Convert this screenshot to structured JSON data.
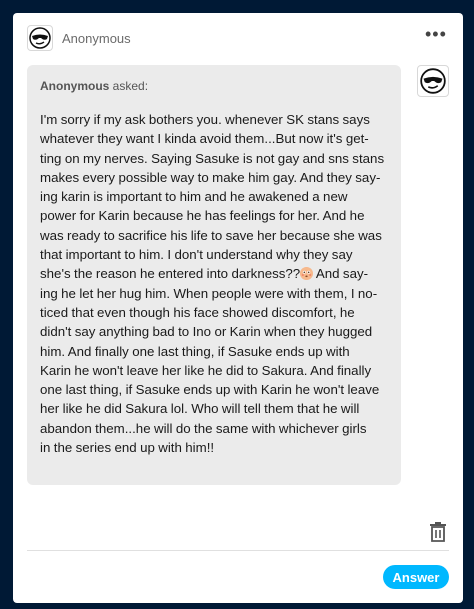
{
  "post": {
    "username": "Anonymous",
    "more_label": "•••"
  },
  "ask": {
    "asker_name": "Anonymous",
    "asked_label": " asked:",
    "question_part1": "I'm sorry if my ask bothers you.  whenever SK stans says\nwhatever they want I kinda avoid them...But now it's get-\nting on my nerves. Saying Sasuke is not gay and sns stans\nmakes every possible way to make him gay. And they say-\ning karin is important to him and he awakened a new\npower for Karin because he has feelings for her. And he\nwas ready to sacrifice his life to save her because she was\nthat important to him. I don't understand why they say\nshe's the reason he entered into darkness??",
    "emoji_icon": "flushed-face-emoji",
    "question_part2": " And say-\ning he let her hug him. When people were with them, I no-\nticed that even though his face showed discomfort, he\ndidn't say anything bad to Ino or Karin when they hugged\nhim. And finally one last thing, if Sasuke ends up with\nKarin he won't leave her like he did to Sakura. And finally\none last thing, if Sasuke ends up with Karin he won't leave\nher like he did Sakura lol. Who will tell them that he will\nabandon them...he will do the same with whichever girls\nin the series end up with him!!"
  },
  "actions": {
    "delete_icon": "trash-icon",
    "answer_label": "Answer"
  },
  "colors": {
    "background": "#001935",
    "bubble": "#ebebeb",
    "accent": "#00b8ff"
  }
}
